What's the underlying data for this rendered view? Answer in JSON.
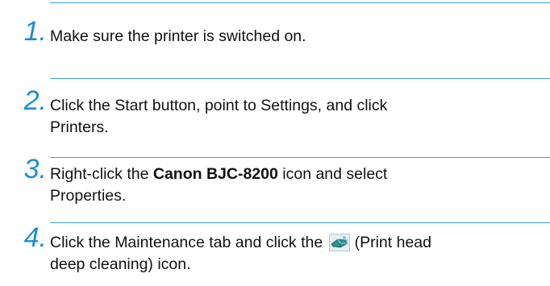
{
  "steps": [
    {
      "number": "1.",
      "text": "Make sure the printer is switched on."
    },
    {
      "number": "2.",
      "line1": "Click the Start button, point to Settings, and click",
      "line2": "Printers."
    },
    {
      "number": "3.",
      "prefix": "Right-click the ",
      "bold": "Canon BJC-8200",
      "suffix": " icon and select",
      "line2": "Properties."
    },
    {
      "number": "4.",
      "prefix": "Click the Maintenance tab and click the",
      "suffix": "(Print head",
      "line2": "deep cleaning) icon.",
      "icon": "print-head-deep-cleaning-icon"
    }
  ],
  "colors": {
    "accent": "#1a8fd0",
    "rule": "#3aa0d8",
    "text": "#111111"
  }
}
